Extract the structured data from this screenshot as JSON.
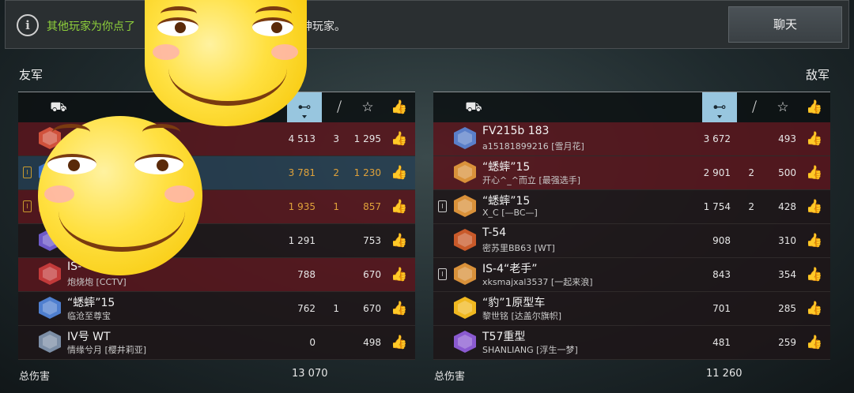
{
  "notice": {
    "highlight": "其他玩家为你点了",
    "rest": "大神玩家。"
  },
  "chat_button": "聊天",
  "left": {
    "title": "友军",
    "total_label": "总伤害",
    "total_value": "13 070",
    "rows": [
      {
        "tank": "",
        "player": "",
        "dmg": "4 513",
        "kills": "3",
        "xp": "1 295",
        "style": "red",
        "badge": "",
        "color": "#d0523c"
      },
      {
        "tank": "",
        "player": "",
        "dmg": "3 781",
        "kills": "2",
        "xp": "1 230",
        "style": "blue gold",
        "badge": "I",
        "color": "#3b73c8"
      },
      {
        "tank": "",
        "player": "",
        "dmg": "1 935",
        "kills": "1",
        "xp": "857",
        "style": "red gold",
        "badge": "I",
        "color": "#b0402e"
      },
      {
        "tank": "",
        "player": "",
        "dmg": "1 291",
        "kills": "",
        "xp": "753",
        "style": "dark",
        "badge": "",
        "color": "#6e5ac8"
      },
      {
        "tank": "IS-",
        "player": "炮烧炮 [CCTV]",
        "dmg": "788",
        "kills": "",
        "xp": "670",
        "style": "red",
        "badge": "",
        "color": "#c23a3a"
      },
      {
        "tank": "“蟋蟀”15",
        "player": "临沧至尊宝",
        "dmg": "762",
        "kills": "1",
        "xp": "670",
        "style": "dark",
        "badge": "",
        "color": "#4f7fcf"
      },
      {
        "tank": "IV号 WT",
        "player": "情缘兮月 [樱井莉亚]",
        "dmg": "0",
        "kills": "",
        "xp": "498",
        "style": "dark",
        "badge": "",
        "color": "#7c8ea6"
      }
    ]
  },
  "right": {
    "title": "敌军",
    "total_label": "总伤害",
    "total_value": "11 260",
    "rows": [
      {
        "tank": "FV215b 183",
        "player": "a15181899216 [雪月花]",
        "dmg": "3 672",
        "kills": "",
        "xp": "493",
        "style": "red",
        "badge": "",
        "color": "#5a7fc9"
      },
      {
        "tank": "“蟋蟀”15",
        "player": "开心^_^而立 [最强选手]",
        "dmg": "2 901",
        "kills": "2",
        "xp": "500",
        "style": "red",
        "badge": "",
        "color": "#d9913a"
      },
      {
        "tank": "“蟋蟀”15",
        "player": "X_C [—BC—]",
        "dmg": "1 754",
        "kills": "2",
        "xp": "428",
        "style": "dark",
        "badge": "I",
        "color": "#d9913a"
      },
      {
        "tank": "T-54",
        "player": "密苏里BB63 [WT]",
        "dmg": "908",
        "kills": "",
        "xp": "310",
        "style": "dark",
        "badge": "",
        "color": "#c95a2a"
      },
      {
        "tank": "IS-4“老手”",
        "player": "xksmajxal3537 [一起来浪]",
        "dmg": "843",
        "kills": "",
        "xp": "354",
        "style": "dark",
        "badge": "I",
        "color": "#d9913a"
      },
      {
        "tank": "“豹”1原型车",
        "player": "黎世铭 [达盖尔旗帜]",
        "dmg": "701",
        "kills": "",
        "xp": "285",
        "style": "dark",
        "badge": "",
        "color": "#f0b820"
      },
      {
        "tank": "T57重型",
        "player": "SHANLIANG [浮生一梦]",
        "dmg": "481",
        "kills": "",
        "xp": "259",
        "style": "dark",
        "badge": "",
        "color": "#8a5ad0"
      }
    ]
  },
  "header_icons": {
    "tank": "tank-icon",
    "damage": "damage-icon",
    "kills": "kills-icon",
    "xp": "star-icon",
    "like": "thumbs-up-icon"
  },
  "glyphs": {
    "tank": "⛟",
    "damage": "⊷",
    "kills": "⧸",
    "xp": "☆",
    "like": "👍"
  }
}
